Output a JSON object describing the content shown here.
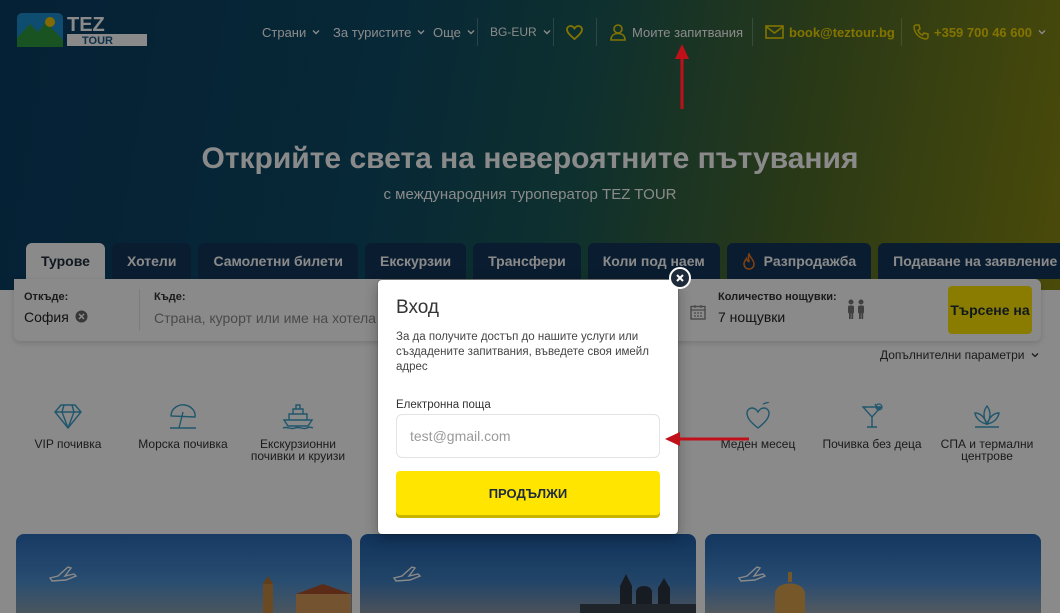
{
  "header": {
    "logo_text_top": "TEZ",
    "logo_text_bottom": "TOUR",
    "nav": {
      "countries": "Страни",
      "for_tourists": "За туристите",
      "more": "Още",
      "currency": "BG-EUR",
      "favorites_icon": "heart-icon",
      "my_inquiries": "Моите запитвания",
      "email": "book@teztour.bg",
      "phone": "+359 700 46 600"
    }
  },
  "hero": {
    "title": "Открийте света на невероятните пътувания",
    "subtitle": "с международния туроператор TEZ TOUR"
  },
  "tabs": [
    {
      "label": "Турове",
      "active": true
    },
    {
      "label": "Хотели"
    },
    {
      "label": "Самолетни билети"
    },
    {
      "label": "Екскурзии"
    },
    {
      "label": "Трансфери"
    },
    {
      "label": "Коли под наем"
    },
    {
      "label": "Разпродажба",
      "icon": "flame-icon"
    },
    {
      "label": "Подаване на заявление"
    }
  ],
  "search": {
    "from_label": "Откъде:",
    "from_value": "София",
    "where_label": "Къде:",
    "where_placeholder": "Страна, курорт или име на хотела",
    "nights_label": "Количество нощувки:",
    "nights_value": "7 нощувки",
    "search_button": "Търсене на",
    "more_params": "Допълнителни параметри"
  },
  "categories": [
    {
      "label": "VIP почивка",
      "icon": "diamond-icon"
    },
    {
      "label": "Морска почивка",
      "icon": "beach-umbrella-icon"
    },
    {
      "label": "Екскурзионни почивки и круизи",
      "icon": "cruise-ship-icon"
    },
    {
      "label": "Меден месец",
      "icon": "honeymoon-icon"
    },
    {
      "label": "Почивка без деца",
      "icon": "cocktail-icon"
    },
    {
      "label": "СПА и термални центрове",
      "icon": "lotus-icon"
    }
  ],
  "modal": {
    "title": "Вход",
    "description": "За да получите достъп до нашите услуги или създадените запитвания, въведете своя имейл адрес",
    "email_label": "Електронна поща",
    "email_placeholder": "test@gmail.com",
    "email_value": "",
    "continue_button": "ПРОДЪЛЖИ"
  },
  "colors": {
    "accent_yellow": "#ffe500",
    "navy": "#1d2b3a",
    "annotation_red": "#c0101a"
  }
}
